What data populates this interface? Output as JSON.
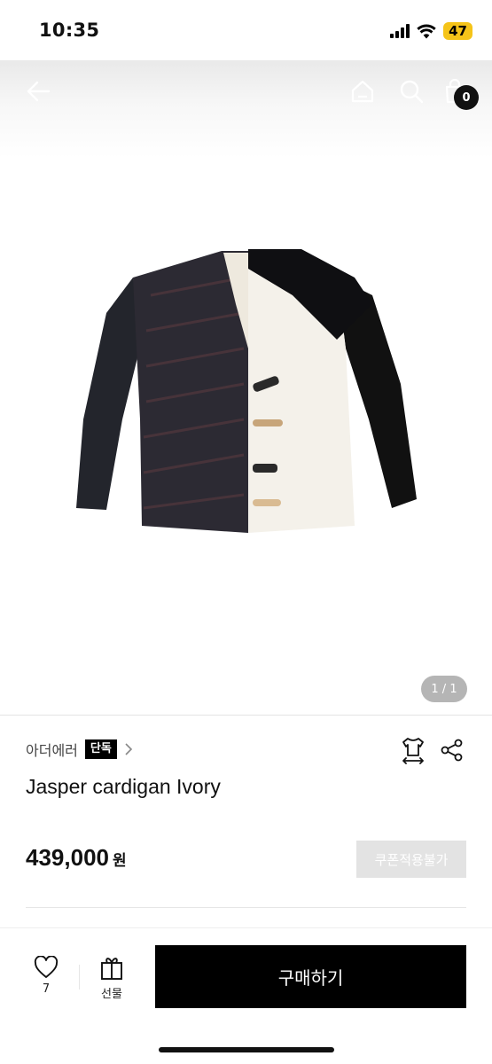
{
  "status_bar": {
    "time": "10:35",
    "battery": "47"
  },
  "header": {
    "cart_count": "0"
  },
  "gallery": {
    "pager": "1 / 1"
  },
  "product": {
    "brand": "아더에러",
    "badge": "단독",
    "title": "Jasper cardigan Ivory",
    "price": "439,000",
    "currency": "원",
    "coupon_label": "쿠폰적용불가"
  },
  "bottom_bar": {
    "like_count": "7",
    "gift_label": "선물",
    "buy_label": "구매하기"
  },
  "icons": [
    "back-icon",
    "home-icon",
    "search-icon",
    "cart-icon",
    "chevron-right-icon",
    "size-guide-icon",
    "share-icon",
    "heart-icon",
    "gift-icon"
  ],
  "colors": {
    "accent": "#000000",
    "battery": "#f5c419",
    "coupon_disabled": "#e3e3e3",
    "pager": "#b5b5b5"
  }
}
